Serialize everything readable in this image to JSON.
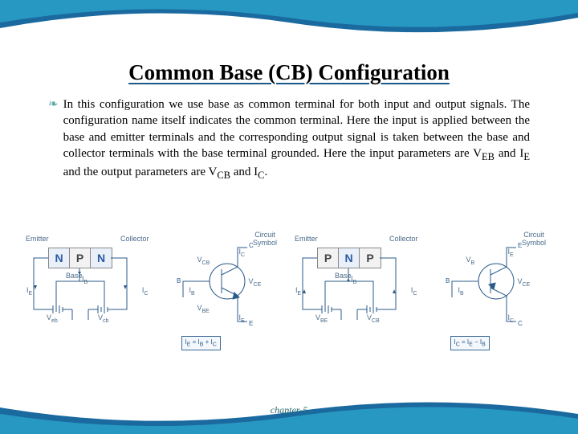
{
  "title": "Common Base (CB) Configuration",
  "body": "In this configuration we use base as common terminal for both input and output signals. The configuration name itself indicates the common terminal. Here the input is applied between the base and emitter terminals and the corresponding output signal is taken between the base and collector terminals with the base terminal grounded. Here the input parameters are Vₑᵦ and Iₑ and the output parameters are V᳋ and I᳌.",
  "body_html": "In this configuration we use base as common terminal for both input and output signals. The configuration name itself indicates the common terminal. Here the input is applied between the base and emitter terminals and the corresponding output signal is taken between the base and collector terminals with the base terminal grounded. Here the input parameters are V<sub>EB</sub> and I<sub>E</sub> and the output parameters are V<sub>CB</sub> and I<sub>C</sub>.",
  "footer": "chapter-5",
  "diagrams": {
    "npn": {
      "layers": [
        "N",
        "P",
        "N"
      ],
      "emitter": "Emitter",
      "collector": "Collector",
      "base": "Base",
      "IE": "I_E",
      "IC": "I_C",
      "IB": "I_B",
      "Veb": "V_eb",
      "Vcb": "V_cb",
      "circuit_symbol": "Circuit Symbol",
      "VCB": "V_CB",
      "VCE": "V_CE",
      "VBE": "V_BE",
      "equation": "I_E = I_B + I_C",
      "terminals": {
        "E": "E",
        "B": "B",
        "C": "C"
      }
    },
    "pnp": {
      "layers": [
        "P",
        "N",
        "P"
      ],
      "emitter": "Emitter",
      "collector": "Collector",
      "base": "Base",
      "IE": "I_E",
      "IC": "I_C",
      "IB": "I_B",
      "VBE": "V_BE",
      "VCB": "V_CB",
      "circuit_symbol": "Circuit Symbol",
      "VCE": "V_CE",
      "equation": "I_C = I_E - I_B",
      "terminals": {
        "E": "E",
        "B": "B",
        "C": "C"
      }
    }
  }
}
